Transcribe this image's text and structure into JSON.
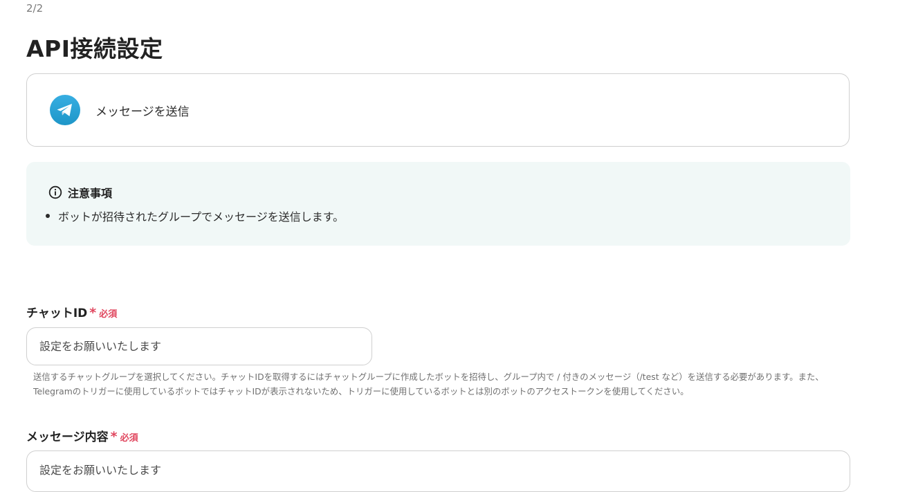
{
  "header": {
    "step": "2/2",
    "title": "API接続設定"
  },
  "action": {
    "icon": "telegram-icon",
    "label": "メッセージを送信"
  },
  "notice": {
    "icon": "info-circle-icon",
    "title": "注意事項",
    "items": [
      "ボットが招待されたグループでメッセージを送信します。"
    ]
  },
  "fields": [
    {
      "label": "チャットID",
      "required_mark": "*",
      "required_text": "必須",
      "placeholder": "設定をお願いいたします",
      "help": "送信するチャットグループを選択してください。チャットIDを取得するにはチャットグループに作成したボットを招待し、グループ内で / 付きのメッセージ（/test など）を送信する必要があります。また、Telegramのトリガーに使用しているボットではチャットIDが表示されないため、トリガーに使用しているボットとは別のボットのアクセストークンを使用してください。"
    },
    {
      "label": "メッセージ内容",
      "required_mark": "*",
      "required_text": "必須",
      "placeholder": "設定をお願いいたします"
    }
  ],
  "colors": {
    "telegram": "#2aa3df",
    "required": "#e0465e",
    "notice_bg": "#f1f8f7"
  }
}
